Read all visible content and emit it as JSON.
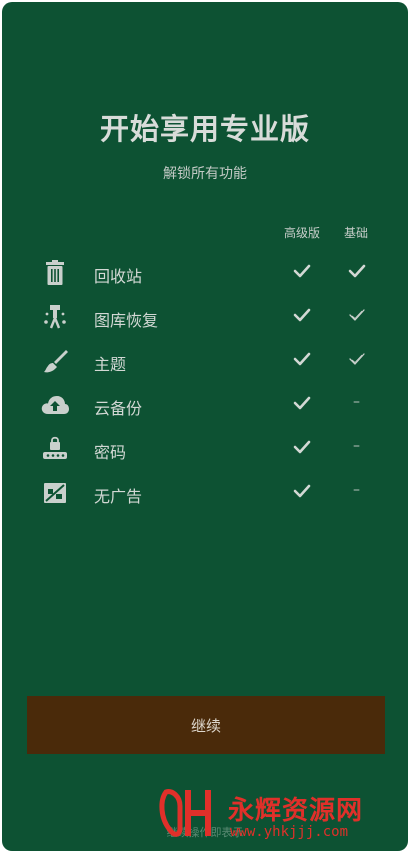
{
  "header": {
    "title": "开始享用专业版",
    "subtitle": "解锁所有功能"
  },
  "columns": {
    "pro": "高级版",
    "basic": "基础"
  },
  "features": [
    {
      "label": "回收站",
      "icon": "trash-icon",
      "pro": "check",
      "basic": "check"
    },
    {
      "label": "图库恢复",
      "icon": "photo-restore-icon",
      "pro": "check",
      "basic": "check-outline"
    },
    {
      "label": "主题",
      "icon": "brush-icon",
      "pro": "check",
      "basic": "check-outline"
    },
    {
      "label": "云备份",
      "icon": "cloud-upload-icon",
      "pro": "check",
      "basic": "–"
    },
    {
      "label": "密码",
      "icon": "password-icon",
      "pro": "check",
      "basic": "–"
    },
    {
      "label": "无广告",
      "icon": "no-ads-icon",
      "pro": "check",
      "basic": "–"
    }
  ],
  "continue_label": "继续",
  "footer_text": "继续操作即表示",
  "watermark": {
    "brand": "永辉资源网",
    "url": "www.yhkjjj.com"
  },
  "colors": {
    "background": "#0d5233",
    "button": "#4a2a0a",
    "watermark": "#e0302a"
  }
}
